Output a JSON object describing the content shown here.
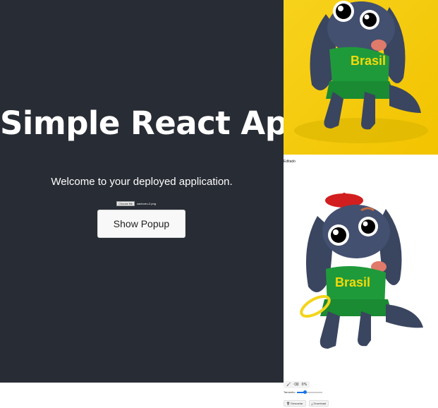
{
  "app": {
    "title": "Simple React App",
    "welcome": "Welcome to your deployed application.",
    "file_button": "Choose file",
    "file_name": "cachorro-2.png",
    "show_popup": "Show Popup"
  },
  "editor": {
    "edited_label": "Editado",
    "tools": [
      "brush-icon",
      "eraser-icon"
    ],
    "zoom": "0%",
    "size_label": "Tamanho",
    "size_value": 0.3,
    "discard_label": "Descartar",
    "download_label": "Download",
    "shirt_text": "Brasil"
  },
  "colors": {
    "background_dark": "#282c34",
    "image_background": "#f7d21c",
    "dog_body": "#3a4560",
    "shirt_green": "#1f9a3a",
    "shirt_text": "#f5d90a",
    "beret_red": "#d21e1e",
    "halo_yellow": "#f3d51a",
    "accent_blue": "#1a73e8"
  }
}
